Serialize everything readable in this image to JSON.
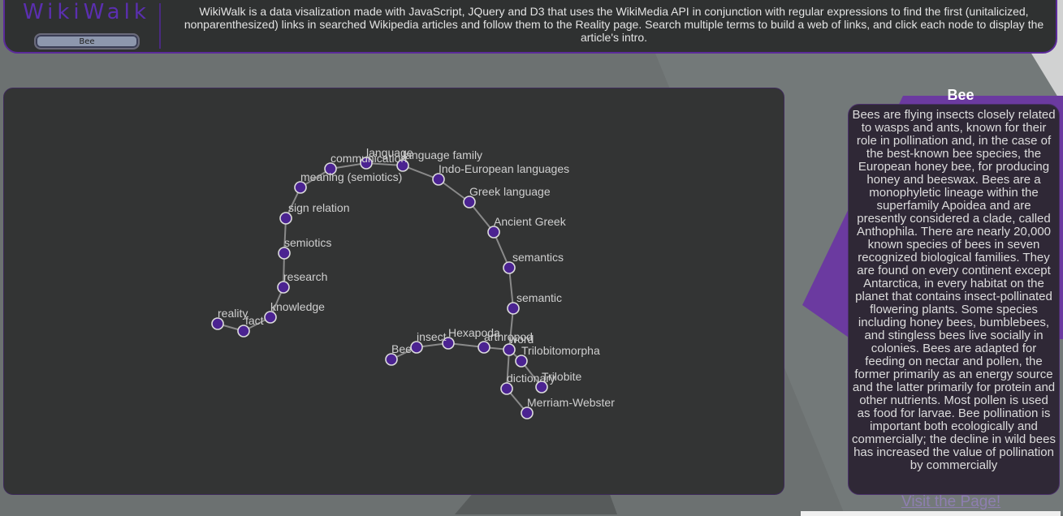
{
  "header": {
    "logo": "WikiWalk",
    "search_value": "Bee",
    "description": "WikiWalk is a data visalization made with JavaScript, JQuery and D3 that uses the WikiMedia API in conjunction with regular expressions to find the first (unitalicized, nonparenthesized) links in searched Wikipedia articles and follow them to the Reality page. Search multiple terms to build a web of links, and click each node to display the article's intro."
  },
  "graph": {
    "nodes": [
      {
        "id": "reality",
        "label": "reality"
      },
      {
        "id": "fact",
        "label": "fact"
      },
      {
        "id": "knowledge",
        "label": "knowledge"
      },
      {
        "id": "research",
        "label": "research"
      },
      {
        "id": "semiotics",
        "label": "semiotics"
      },
      {
        "id": "sign relation",
        "label": "sign relation"
      },
      {
        "id": "meaning (semiotics)",
        "label": "meaning (semiotics)"
      },
      {
        "id": "communication",
        "label": "communication"
      },
      {
        "id": "language",
        "label": "language"
      },
      {
        "id": "language family",
        "label": "language family"
      },
      {
        "id": "Indo-European languages",
        "label": "Indo-European languages"
      },
      {
        "id": "Greek language",
        "label": "Greek language"
      },
      {
        "id": "Ancient Greek",
        "label": "Ancient Greek"
      },
      {
        "id": "semantics",
        "label": "semantics"
      },
      {
        "id": "semantic",
        "label": "semantic"
      },
      {
        "id": "word",
        "label": "word"
      },
      {
        "id": "arthropod",
        "label": "arthropod"
      },
      {
        "id": "Hexapoda",
        "label": "Hexapoda"
      },
      {
        "id": "insect",
        "label": "insect"
      },
      {
        "id": "Bee",
        "label": "Bee"
      },
      {
        "id": "Trilobitomorpha",
        "label": "Trilobitomorpha"
      },
      {
        "id": "Trilobite",
        "label": "Trilobite"
      },
      {
        "id": "dictionary",
        "label": "dictionary"
      },
      {
        "id": "Merriam-Webster",
        "label": "Merriam-Webster"
      }
    ],
    "links": [
      [
        "fact",
        "reality"
      ],
      [
        "knowledge",
        "fact"
      ],
      [
        "research",
        "knowledge"
      ],
      [
        "semiotics",
        "research"
      ],
      [
        "sign relation",
        "semiotics"
      ],
      [
        "meaning (semiotics)",
        "sign relation"
      ],
      [
        "communication",
        "meaning (semiotics)"
      ],
      [
        "language",
        "communication"
      ],
      [
        "language family",
        "language"
      ],
      [
        "Indo-European languages",
        "language family"
      ],
      [
        "Greek language",
        "Indo-European languages"
      ],
      [
        "Ancient Greek",
        "Greek language"
      ],
      [
        "semantics",
        "Ancient Greek"
      ],
      [
        "semantic",
        "semantics"
      ],
      [
        "word",
        "semantic"
      ],
      [
        "arthropod",
        "word"
      ],
      [
        "Hexapoda",
        "arthropod"
      ],
      [
        "insect",
        "Hexapoda"
      ],
      [
        "Bee",
        "insect"
      ],
      [
        "Trilobitomorpha",
        "word"
      ],
      [
        "Trilobite",
        "Trilobitomorpha"
      ],
      [
        "dictionary",
        "word"
      ],
      [
        "Merriam-Webster",
        "dictionary"
      ]
    ]
  },
  "article": {
    "title": "Bee",
    "intro": "Bees are flying insects closely related to wasps and ants, known for their role in pollination and, in the case of the best-known bee species, the European honey bee, for producing honey and beeswax. Bees are a monophyletic lineage within the superfamily Apoidea and are presently considered a clade, called Anthophila. There are nearly 20,000 known species of bees in seven recognized biological families. They are found on every continent except Antarctica, in every habitat on the planet that contains insect-pollinated flowering plants. Some species including honey bees, bumblebees, and stingless bees live socially in colonies. Bees are adapted for feeding on nectar and pollen, the former primarily as an energy source and the latter primarily for protein and other nutrients. Most pollen is used as food for larvae. Bee pollination is important both ecologically and commercially; the decline in wild bees has increased the value of pollination by commercially",
    "visit_link": "Visit the Page!"
  },
  "colors": {
    "accent": "#5b2a9a",
    "node_fill": "#4b2391",
    "panel": "#333434",
    "background": "#6c7171"
  }
}
